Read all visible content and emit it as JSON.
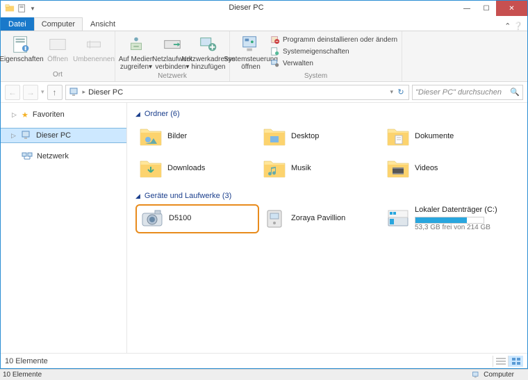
{
  "window_title": "Dieser PC",
  "tabs": {
    "file": "Datei",
    "computer": "Computer",
    "view": "Ansicht"
  },
  "ribbon": {
    "grp_ort": "Ort",
    "grp_netz": "Netzwerk",
    "grp_sys": "System",
    "properties": "Eigenschaften",
    "open": "Öffnen",
    "rename": "Umbenennen",
    "media": "Auf Medien\nzugreifen▾",
    "mapdrive": "Netzlaufwerk\nverbinden▾",
    "addnet": "Netzwerkadresse\nhinzufügen",
    "control": "Systemsteuerung\nöffnen",
    "sm1": "Programm deinstallieren oder ändern",
    "sm2": "Systemeigenschaften",
    "sm3": "Verwalten"
  },
  "breadcrumb": "Dieser PC",
  "search_placeholder": "\"Dieser PC\" durchsuchen",
  "sidebar": {
    "favorites": "Favoriten",
    "thispc": "Dieser PC",
    "network": "Netzwerk"
  },
  "groups": {
    "folders_hdr": "Ordner (6)",
    "folders": [
      {
        "label": "Bilder"
      },
      {
        "label": "Desktop"
      },
      {
        "label": "Dokumente"
      },
      {
        "label": "Downloads"
      },
      {
        "label": "Musik"
      },
      {
        "label": "Videos"
      }
    ],
    "drives_hdr": "Geräte und Laufwerke (3)",
    "drives": [
      {
        "label": "D5100"
      },
      {
        "label": "Zoraya Pavillion"
      },
      {
        "label": "Lokaler Datenträger (C:)",
        "sub": "53,3 GB frei von 214 GB",
        "used_pct": 75
      }
    ]
  },
  "status": "10 Elemente",
  "taskbar": {
    "left": "10 Elemente",
    "right": "Computer"
  }
}
